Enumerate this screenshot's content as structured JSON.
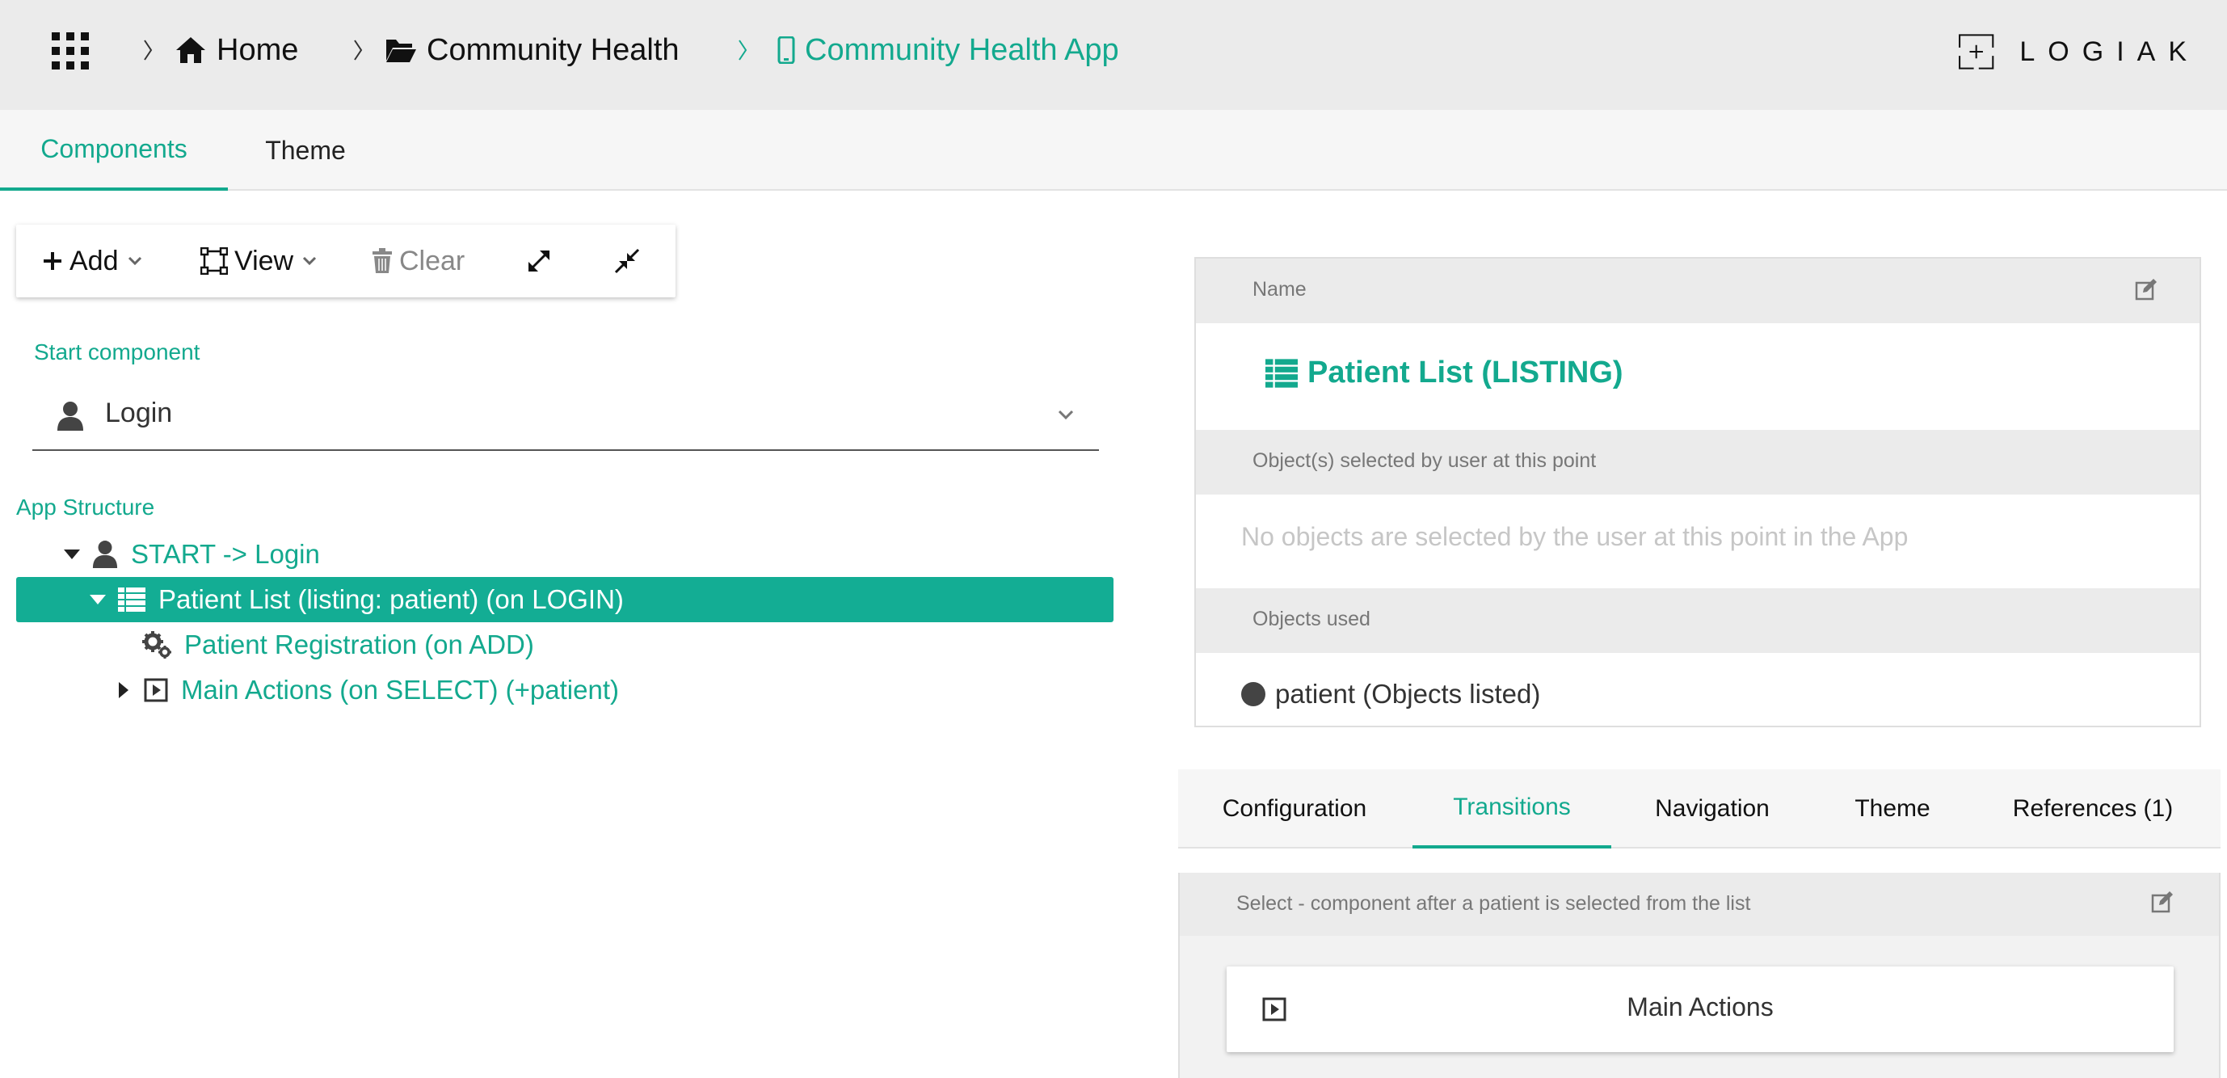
{
  "breadcrumbs": [
    {
      "label": "Home",
      "icon": "home-icon"
    },
    {
      "label": "Community Health",
      "icon": "folder-open-icon"
    },
    {
      "label": "Community Health App",
      "icon": "mobile-icon"
    }
  ],
  "logo": {
    "text": "LOGIAK",
    "mark": "+"
  },
  "top_tabs": [
    {
      "label": "Components",
      "active": true
    },
    {
      "label": "Theme",
      "active": false
    }
  ],
  "toolbar": {
    "add_label": "Add",
    "view_label": "View",
    "clear_label": "Clear",
    "expand_icon": "expand-arrows-icon",
    "collapse_icon": "compress-arrows-icon"
  },
  "start_component": {
    "label": "Start component",
    "value": "Login",
    "icon": "user-icon"
  },
  "app_structure": {
    "label": "App Structure",
    "items": [
      {
        "label": "START -> Login",
        "icon": "user-icon",
        "toggle": "expanded",
        "level": 0,
        "selected": false
      },
      {
        "label": "Patient List (listing: patient) (on LOGIN)",
        "icon": "list-icon",
        "toggle": "expanded",
        "level": 1,
        "selected": true
      },
      {
        "label": "Patient Registration (on ADD)",
        "icon": "cogs-icon",
        "toggle": "none",
        "level": 2,
        "selected": false
      },
      {
        "label": "Main Actions (on SELECT) (+patient)",
        "icon": "play-square-icon",
        "toggle": "collapsed",
        "level": 2,
        "selected": false
      }
    ]
  },
  "details": {
    "name_label": "Name",
    "name_value": "Patient List (LISTING)",
    "selected_label": "Object(s) selected by user at this point",
    "selected_empty": "No objects are selected by the user at this point in the App",
    "used_label": "Objects used",
    "used_items": [
      "patient (Objects listed)"
    ]
  },
  "detail_tabs": [
    {
      "label": "Configuration",
      "active": false
    },
    {
      "label": "Transitions",
      "active": true
    },
    {
      "label": "Navigation",
      "active": false
    },
    {
      "label": "Theme",
      "active": false
    },
    {
      "label": "References (1)",
      "active": false
    }
  ],
  "transitions": {
    "select_label": "Select - component after a patient is selected from the list",
    "target": "Main Actions"
  },
  "colors": {
    "accent": "#13a98e",
    "selected_row": "#13ad94",
    "band": "#ebebeb",
    "topbar": "#ebebeb"
  }
}
